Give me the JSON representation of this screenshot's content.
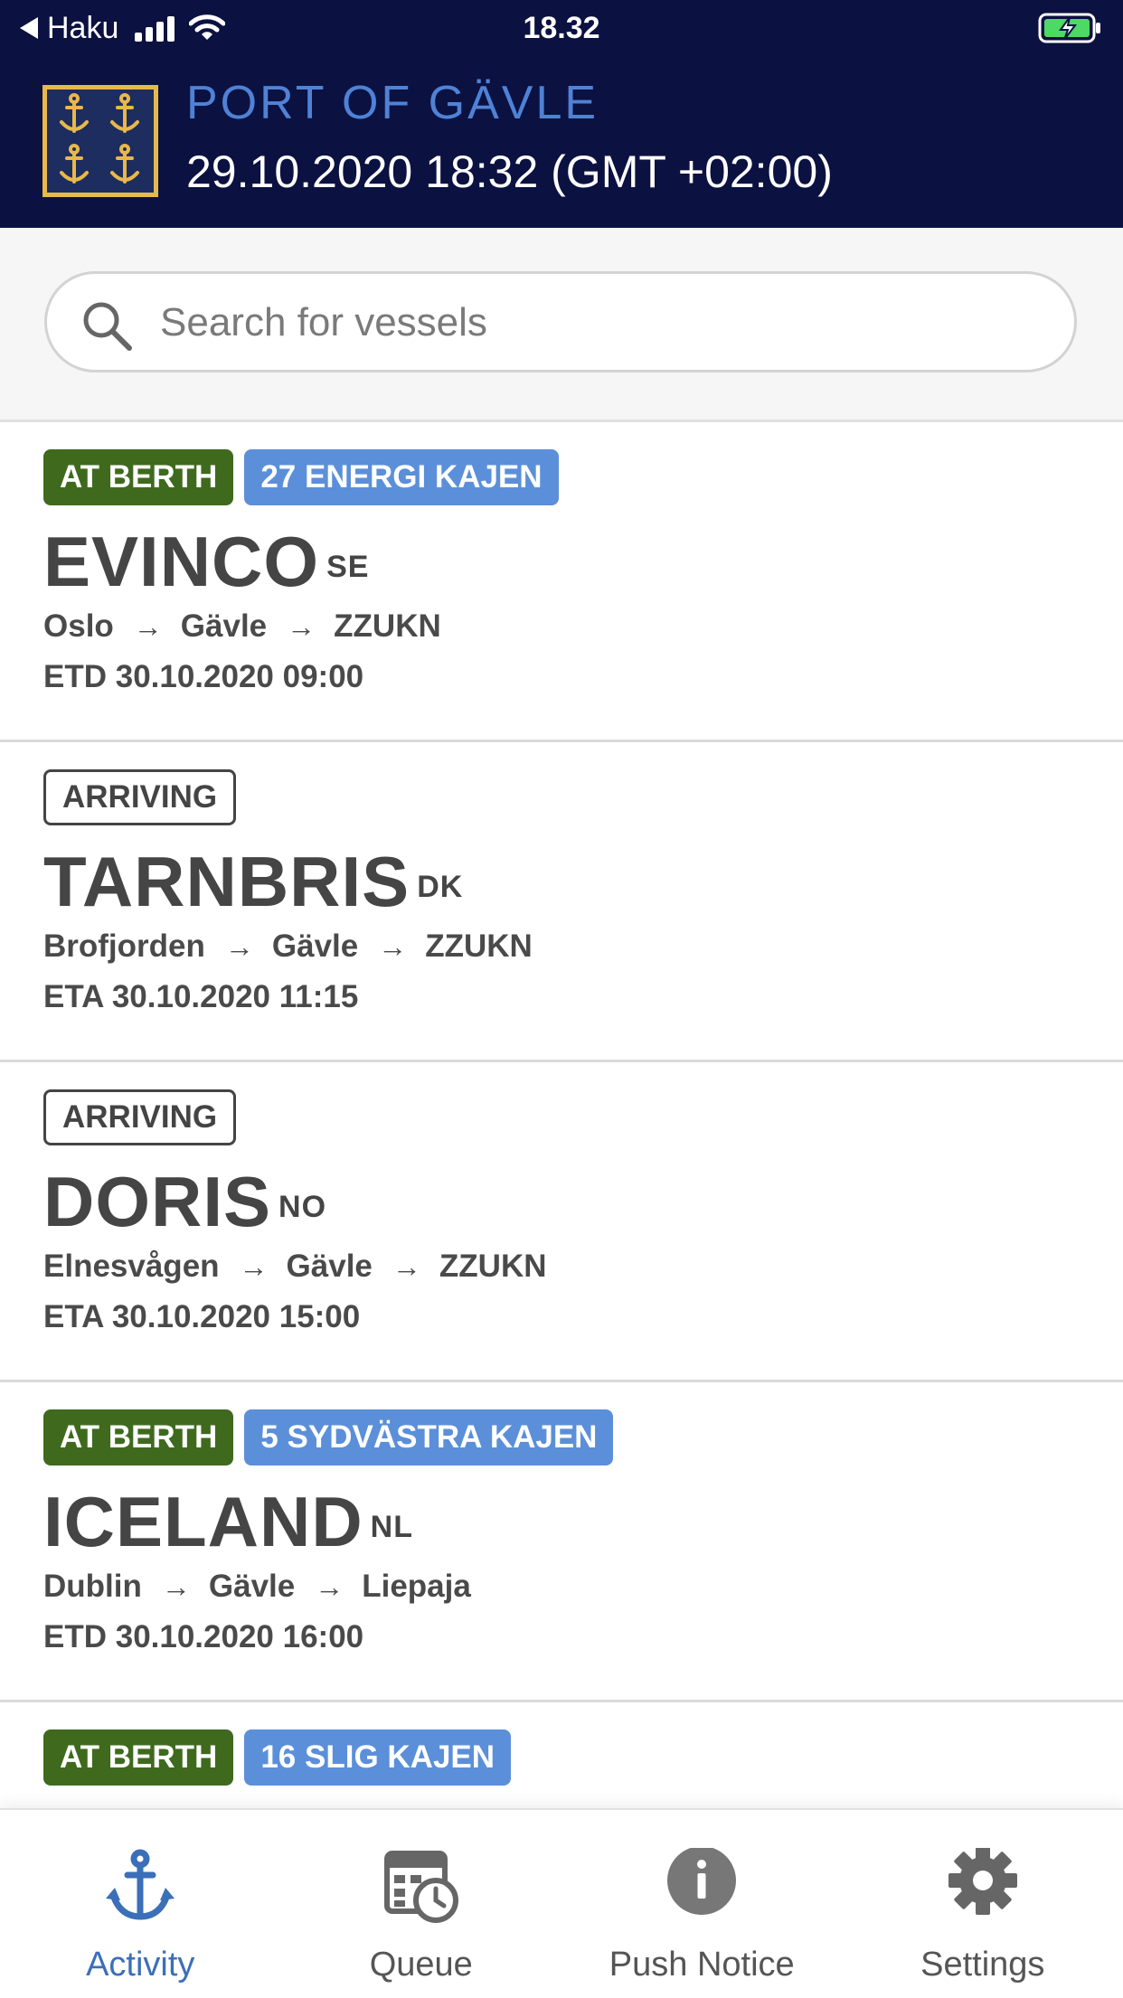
{
  "status_bar": {
    "back_app": "Haku",
    "time": "18.32"
  },
  "header": {
    "title": "PORT OF GÄVLE",
    "datetime": "29.10.2020 18:32 (GMT +02:00)"
  },
  "search": {
    "placeholder": "Search for vessels",
    "value": ""
  },
  "vessels": [
    {
      "status": "AT BERTH",
      "berth": "27 ENERGI KAJEN",
      "name": "EVINCO",
      "flag": "SE",
      "from": "Oslo",
      "via": "Gävle",
      "to": "ZZUKN",
      "time": "ETD 30.10.2020 09:00"
    },
    {
      "status": "ARRIVING",
      "berth": "",
      "name": "TARNBRIS",
      "flag": "DK",
      "from": "Brofjorden",
      "via": "Gävle",
      "to": "ZZUKN",
      "time": "ETA 30.10.2020 11:15"
    },
    {
      "status": "ARRIVING",
      "berth": "",
      "name": "DORIS",
      "flag": "NO",
      "from": "Elnesvågen",
      "via": "Gävle",
      "to": "ZZUKN",
      "time": "ETA 30.10.2020 15:00"
    },
    {
      "status": "AT BERTH",
      "berth": "5 SYDVÄSTRA KAJEN",
      "name": "ICELAND",
      "flag": "NL",
      "from": "Dublin",
      "via": "Gävle",
      "to": "Liepaja",
      "time": "ETD 30.10.2020 16:00"
    },
    {
      "status": "AT BERTH",
      "berth": "16 SLIG KAJEN",
      "name": "",
      "flag": "",
      "from": "",
      "via": "",
      "to": "",
      "time": ""
    }
  ],
  "route_arrow": "→",
  "nav": {
    "activity": "Activity",
    "queue": "Queue",
    "push_notice": "Push Notice",
    "settings": "Settings"
  },
  "colors": {
    "header_bg": "#0b1140",
    "title_blue": "#4f82d6",
    "at_berth_green": "#3f6a1e",
    "berth_blue": "#5b8fd9",
    "active_nav": "#3b6fb8"
  },
  "icons": {
    "search": "search-icon",
    "activity": "anchor-icon",
    "queue": "calendar-clock-icon",
    "push_notice": "info-icon",
    "settings": "gear-icon"
  }
}
